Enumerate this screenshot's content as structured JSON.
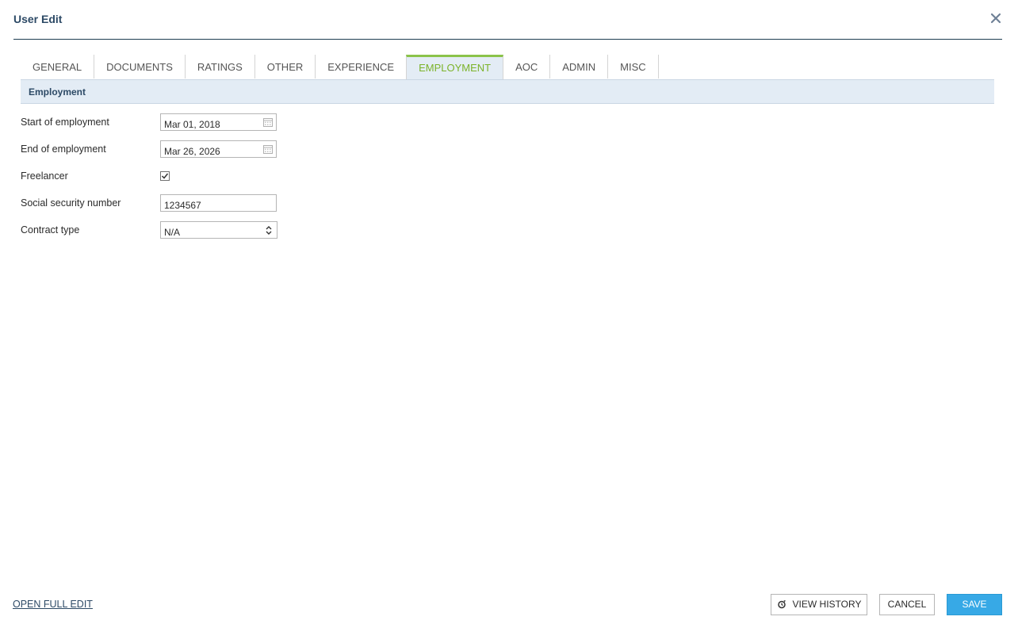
{
  "dialog": {
    "title": "User Edit"
  },
  "tabs": [
    {
      "label": "GENERAL"
    },
    {
      "label": "DOCUMENTS"
    },
    {
      "label": "RATINGS"
    },
    {
      "label": "OTHER"
    },
    {
      "label": "EXPERIENCE"
    },
    {
      "label": "EMPLOYMENT",
      "active": true
    },
    {
      "label": "AOC"
    },
    {
      "label": "ADMIN"
    },
    {
      "label": "MISC"
    }
  ],
  "section": {
    "title": "Employment"
  },
  "form": {
    "start_label": "Start of employment",
    "start_value": "Mar 01, 2018",
    "end_label": "End of employment",
    "end_value": "Mar 26, 2026",
    "freelancer_label": "Freelancer",
    "freelancer_checked": true,
    "ssn_label": "Social security number",
    "ssn_value": "1234567",
    "contract_label": "Contract type",
    "contract_value": "N/A"
  },
  "footer": {
    "open_full_edit": "OPEN FULL EDIT",
    "view_history": "VIEW HISTORY",
    "cancel": "CANCEL",
    "save": "SAVE"
  },
  "colors": {
    "accent_green": "#8bc34a",
    "save_blue": "#37a9e6",
    "title_navy": "#2d4a66"
  }
}
